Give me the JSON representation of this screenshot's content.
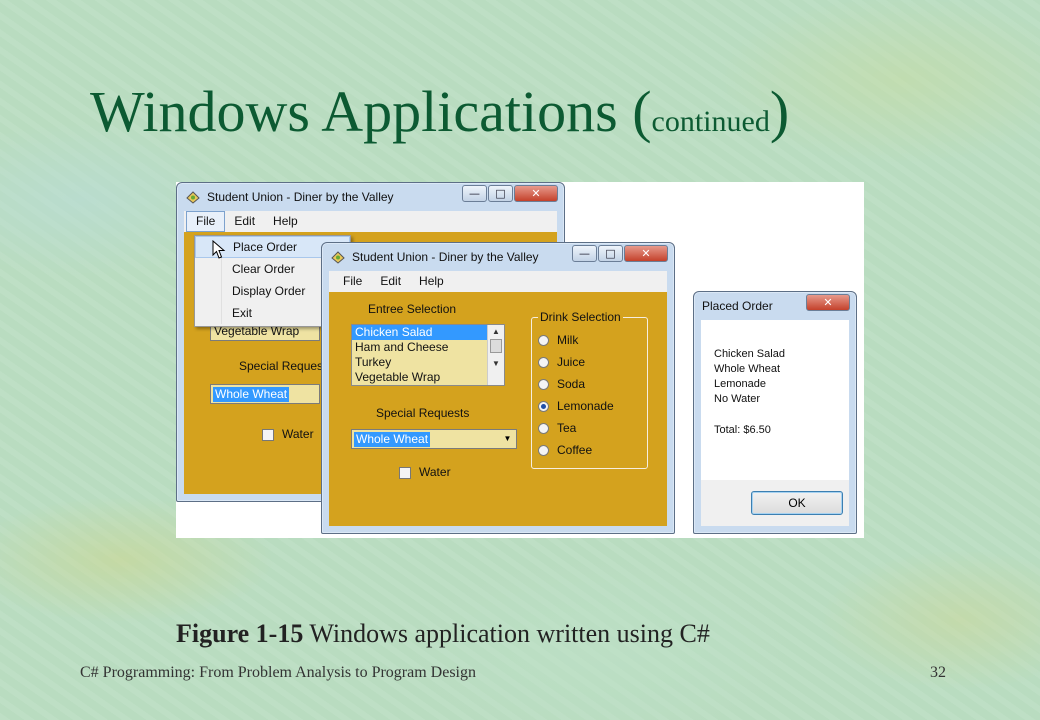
{
  "slide": {
    "title_main": "Windows Applications (",
    "title_small": "continued",
    "title_close": ")",
    "caption_bold": "Figure 1-15",
    "caption_text": " Windows application written using C#",
    "footer_left": "C# Programming: From Problem Analysis to Program Design",
    "page_number": "32"
  },
  "back_window": {
    "title": "Student Union   -   Diner by the Valley",
    "menu": [
      "File",
      "Edit",
      "Help"
    ],
    "file_menu_items": [
      "Place Order",
      "Clear Order",
      "Display Order",
      "Exit"
    ],
    "visible_entree": "Vegetable Wrap",
    "special_requests_label": "Special Requests",
    "special_requests_value": "Whole Wheat",
    "water_label": "Water"
  },
  "front_window": {
    "title": "Student Union   -   Diner by the Valley",
    "menu": [
      "File",
      "Edit",
      "Help"
    ],
    "entree_label": "Entree Selection",
    "entrees": [
      "Chicken Salad",
      "Ham and Cheese",
      "Turkey",
      "Vegetable Wrap"
    ],
    "selected_entree": "Chicken Salad",
    "special_requests_label": "Special Requests",
    "special_requests_value": "Whole Wheat",
    "water_label": "Water",
    "drink_group_label": "Drink Selection",
    "drinks": [
      "Milk",
      "Juice",
      "Soda",
      "Lemonade",
      "Tea",
      "Coffee"
    ],
    "selected_drink": "Lemonade"
  },
  "dialog": {
    "title": "Placed Order",
    "lines": [
      "Chicken Salad",
      "Whole Wheat",
      "Lemonade",
      "No Water"
    ],
    "total": "Total: $6.50",
    "ok_label": "OK"
  },
  "colors": {
    "title_green": "#0c5a32",
    "form_background": "#d4a21e",
    "control_background": "#efe3a2",
    "selection_blue": "#3399ff"
  }
}
